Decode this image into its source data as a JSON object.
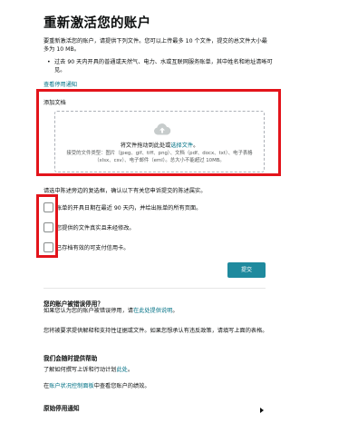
{
  "page": {
    "title": "重新激活您的账户",
    "intro": "要重新激活您的账户，请提供下列文件。您可以上传最多 10 个文件，提交的总文件大小最多为 10 MB。",
    "bullet": "过去 90 天内开具的普通或天然气、电力、水或互联网服务账单，其中姓名和地址清晰可见。",
    "notice_link": "查看停用通知"
  },
  "upload": {
    "label": "添加文档",
    "drop_prefix": "将文件拖动到此处或",
    "drop_link": "选择文件",
    "drop_suffix": "。",
    "hint": "接受的文件类型：图片（jpeg、gif、tiff、png）、文档（pdf、docx、txt）、电子表格（xlsx、csv）、电子邮件（eml）。总大小不能超过 10MB。",
    "icon": "cloud-upload-icon"
  },
  "confirm": {
    "text": "请选中陈述旁边的复选框，确认以下有关您申诉提交的陈述属实。",
    "items": [
      {
        "label": "账单的开具日期在最近 90 天内，并给出账单的所有页面。"
      },
      {
        "label": "您提供的文件真实且未经修改。"
      },
      {
        "label": "已存档有效的可支付信用卡。"
      }
    ]
  },
  "submit_label": "提交",
  "help": {
    "wrong_title": "您的账户被错误停用？",
    "wrong_prefix": "如果您认为您的账户被错误停用，请",
    "wrong_link": "在此处提供说明",
    "wrong_suffix": "。",
    "policy": "您将被要求提供解释和支持性证据或文件。如果您想承认有违反政策，请填写上面的表格。",
    "when_title": "我们会随时提供帮助",
    "appeal_prefix": "了解如何撰写上诉和行动计划",
    "appeal_link": "此处",
    "appeal_suffix": "。",
    "dash_prefix": "在",
    "dash_link": "账户状况控制面板",
    "dash_suffix": "中查看您账户的绩效。",
    "original_notice": "原始停用通知"
  },
  "colors": {
    "link": "#007185",
    "button": "#1f8a9e",
    "highlight": "#e3141b"
  }
}
